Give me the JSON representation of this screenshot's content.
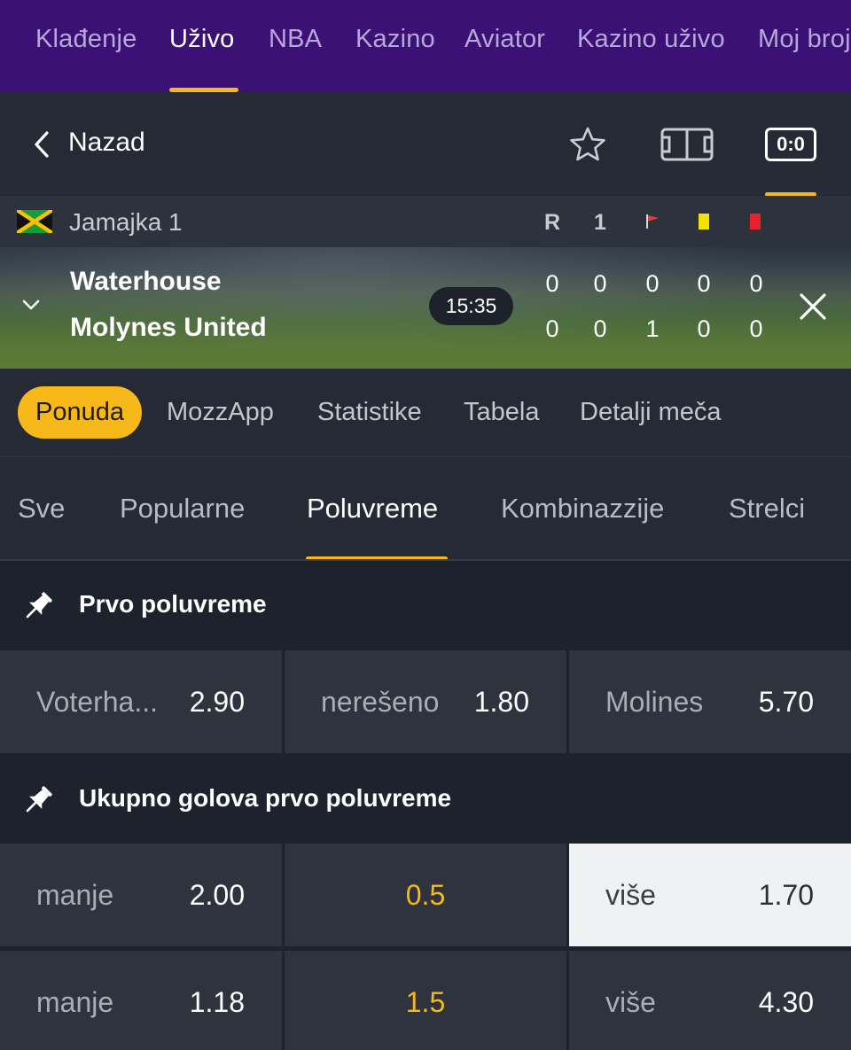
{
  "topnav": {
    "items": [
      "Klađenje",
      "Uživo",
      "NBA",
      "Kazino",
      "Aviator",
      "Kazino uživo",
      "Moj broj"
    ],
    "active_index": 1
  },
  "header": {
    "back_label": "Nazad",
    "score_button_label": "0:0"
  },
  "match": {
    "league": "Jamajka 1",
    "columns": [
      "R",
      "1"
    ],
    "time": "15:35",
    "home": {
      "name": "Waterhouse",
      "stats": [
        "0",
        "0",
        "0",
        "0",
        "0"
      ]
    },
    "away": {
      "name": "Molynes United",
      "stats": [
        "0",
        "0",
        "1",
        "0",
        "0"
      ]
    }
  },
  "subtabs": {
    "items": [
      "Ponuda",
      "MozzApp",
      "Statistike",
      "Tabela",
      "Detalji meča"
    ],
    "active": "Ponuda"
  },
  "market_tabs": {
    "items": [
      "Sve",
      "Popularne",
      "Poluvreme",
      "Kombinazzije",
      "Strelci"
    ],
    "active": "Poluvreme"
  },
  "sections": [
    {
      "title": "Prvo poluvreme",
      "row": [
        {
          "label": "Voterha...",
          "odd": "2.90"
        },
        {
          "label": "nerešeno",
          "odd": "1.80"
        },
        {
          "label": "Molines",
          "odd": "5.70"
        }
      ]
    },
    {
      "title": "Ukupno golova prvo poluvreme",
      "rows": [
        {
          "under_label": "manje",
          "under_odd": "2.00",
          "line": "0.5",
          "over_label": "više",
          "over_odd": "1.70",
          "over_selected": true
        },
        {
          "under_label": "manje",
          "under_odd": "1.18",
          "line": "1.5",
          "over_label": "više",
          "over_odd": "4.30",
          "over_selected": false
        }
      ]
    }
  ],
  "colors": {
    "nav_bg": "#3b1175",
    "accent": "#f7b91a",
    "panel": "#252a35",
    "cell": "#2e333e",
    "selected_cell": "#f0f1f3"
  }
}
